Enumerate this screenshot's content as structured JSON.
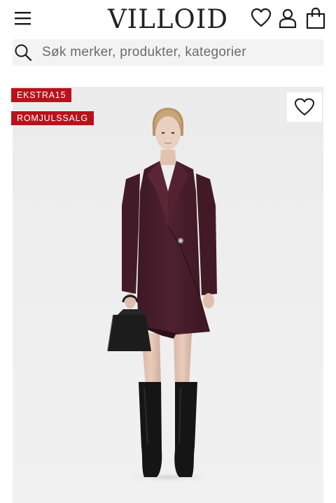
{
  "header": {
    "logo_text": "VILLOID",
    "icons": [
      "menu-icon",
      "heart-icon",
      "user-icon",
      "shopping-bag-icon"
    ]
  },
  "search": {
    "placeholder": "Søk merker, produkter, kategorier",
    "value": ""
  },
  "product_card": {
    "badges": [
      "EKSTRA15",
      "ROMJULSSALG"
    ],
    "badge_color": "#b8121c",
    "image_description_icon": "product-photo",
    "colors": {
      "dress": "#4a1f2c",
      "boots": "#171717",
      "bag": "#1c1c1c",
      "background": "#ededed"
    }
  }
}
